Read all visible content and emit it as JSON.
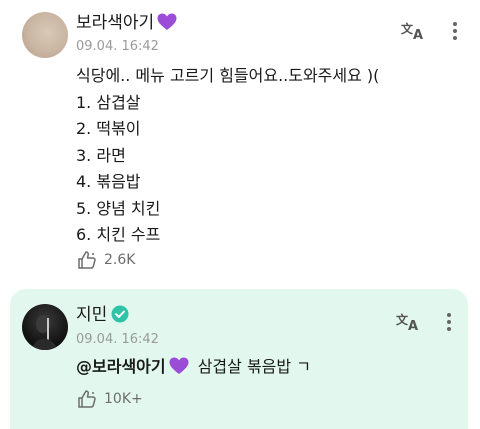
{
  "post": {
    "author_name": "보라색아기",
    "timestamp": "09.04. 16:42",
    "intro": "식당에.. 메뉴 고르기 힘들어요..도와주세요 )(",
    "menu_items": [
      "1. 삼겹살",
      "2. 떡볶이",
      "3. 라면",
      "4. 볶음밥",
      "5. 양념 치킨",
      "6. 치킨 수프"
    ],
    "like_count": "2.6K"
  },
  "reply": {
    "author_name": "지민",
    "timestamp": "09.04. 16:42",
    "mention": "@보라색아기",
    "text": "삼겹살 볶음밥 ㄱ",
    "like_count": "10K+"
  },
  "icons": {
    "heart": "purple-heart-emoji",
    "verified": "verified-badge",
    "translate": "translate-icon",
    "more": "more-vertical-icon",
    "like": "like-icon"
  },
  "colors": {
    "heart": "#9b4dd8",
    "verified": "#2fc4a8",
    "reply_background": "#e2f8ef",
    "timestamp": "#9a9a9a"
  }
}
